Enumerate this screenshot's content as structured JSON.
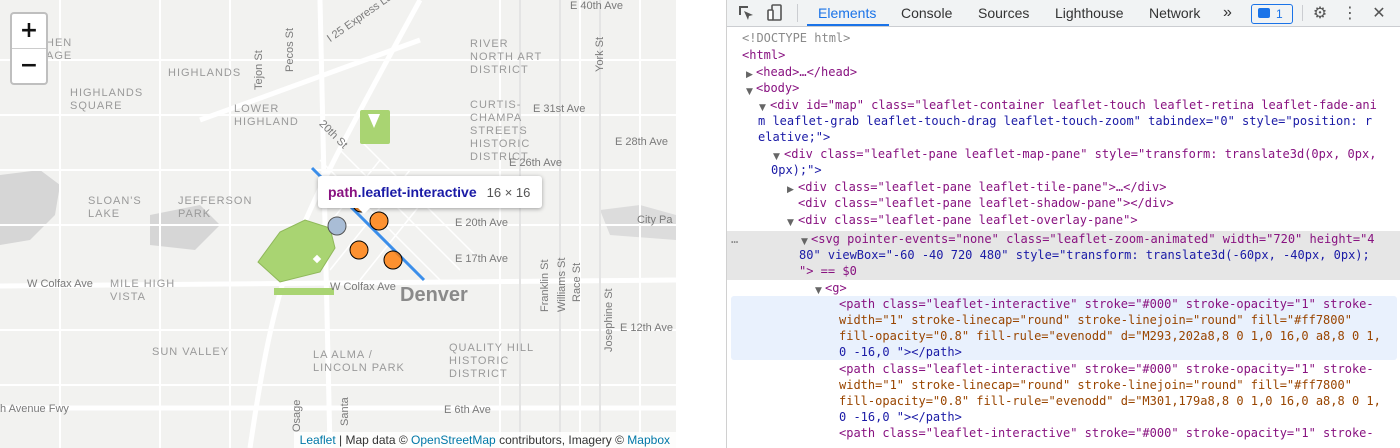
{
  "map": {
    "zoom_in": "+",
    "zoom_out": "−",
    "city": "Denver",
    "labels": {
      "highlands_square": "HIGHLANDS\nSQUARE",
      "highlands": "HIGHLANDS",
      "lower_highland": "LOWER\nHIGHLAND",
      "river_north": "RIVER\nNORTH ART\nDISTRICT",
      "curtis_champa": "CURTIS-\nCHAMPA\nSTREETS\nHISTORIC\nDISTRICT",
      "sloans_lake": "SLOAN'S\nLAKE",
      "jefferson_park": "JEFFERSON\nPARK",
      "mile_high_vista": "MILE HIGH\nVISTA",
      "sun_valley": "SUN VALLEY",
      "la_alma": "LA ALMA /\nLINCOLN PARK",
      "quality_hill": "QUALITY HILL\nHISTORIC\nDISTRICT",
      "hen_age": "HEN\nAGE"
    },
    "streets": {
      "e40th": "E 40th Ave",
      "i25": "I 25 Express Lanes",
      "tejon": "Tejon St",
      "pecos": "Pecos St",
      "york": "York St",
      "e31st": "E 31st Ave",
      "e28th": "E 28th Ave",
      "e26th": "E 26th Ave",
      "e20th": "E 20th Ave",
      "e17th": "E 17th Ave",
      "w_colfax": "W Colfax Ave",
      "w_colfax2": "W Colfax Ave",
      "franklin": "Franklin St",
      "williams": "Williams St",
      "race": "Race St",
      "josephine": "Josephine St",
      "e12th": "E 12th Ave",
      "e6th": "E 6th Ave",
      "avenue_fwy": "h Avenue Fwy",
      "st20": "20th St",
      "city_park": "City Pa",
      "osage": "Osage",
      "santa": "Santa"
    },
    "tooltip": {
      "tag": "path",
      "cls": ".leaflet-interactive",
      "dims": "16 × 16"
    },
    "attribution": {
      "leaflet": "Leaflet",
      "sep": " | Map data © ",
      "osm": "OpenStreetMap",
      "mid": " contributors, Imagery © ",
      "mapbox": "Mapbox"
    },
    "markers": [
      {
        "fill": "#ff7800",
        "opacity": 0.8
      },
      {
        "fill": "#ff7800",
        "opacity": 0.8
      }
    ],
    "park_color": "#a9d472",
    "highlight_color": "#3b8eea"
  },
  "devtools": {
    "tabs": [
      "Elements",
      "Console",
      "Sources",
      "Lighthouse",
      "Network"
    ],
    "more": "»",
    "issues_count": "1",
    "icons": [
      "inspect-icon",
      "device-toggle-icon",
      "settings-icon",
      "kebab-menu-icon",
      "close-icon"
    ],
    "dom_lines": [
      "<!DOCTYPE html>",
      "<html>",
      "<head>…</head>",
      "<body>",
      "<div id=\"map\" class=\"leaflet-container leaflet-touch leaflet-retina leaflet-fade-ani",
      "m leaflet-grab leaflet-touch-drag leaflet-touch-zoom\" tabindex=\"0\" style=\"position: r",
      "elative;\">",
      "<div class=\"leaflet-pane leaflet-map-pane\" style=\"transform: translate3d(0px, 0px,",
      "0px);\">",
      "<div class=\"leaflet-pane leaflet-tile-pane\">…</div>",
      "<div class=\"leaflet-pane leaflet-shadow-pane\"></div>",
      "<div class=\"leaflet-pane leaflet-overlay-pane\">",
      "<svg pointer-events=\"none\" class=\"leaflet-zoom-animated\" width=\"720\" height=\"4",
      "80\" viewBox=\"-60 -40 720 480\" style=\"transform: translate3d(-60px, -40px, 0px);",
      "\"> == $0",
      "<g>",
      "<path class=\"leaflet-interactive\" stroke=\"#000\" stroke-opacity=\"1\" stroke-",
      "width=\"1\" stroke-linecap=\"round\" stroke-linejoin=\"round\" fill=\"#ff7800\"",
      "fill-opacity=\"0.8\" fill-rule=\"evenodd\" d=\"M293,202a8,8 0 1,0 16,0 a8,8 0 1,",
      "0 -16,0 \"></path>",
      "<path class=\"leaflet-interactive\" stroke=\"#000\" stroke-opacity=\"1\" stroke-",
      "width=\"1\" stroke-linecap=\"round\" stroke-linejoin=\"round\" fill=\"#ff7800\"",
      "fill-opacity=\"0.8\" fill-rule=\"evenodd\" d=\"M301,179a8,8 0 1,0 16,0 a8,8 0 1,",
      "0 -16,0 \"></path>",
      "<path class=\"leaflet-interactive\" stroke=\"#000\" stroke-opacity=\"1\" stroke-"
    ]
  }
}
